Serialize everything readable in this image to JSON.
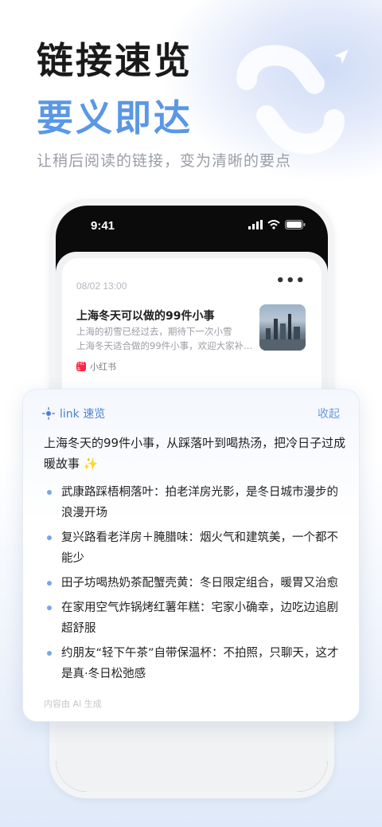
{
  "hero": {
    "title": "链接速览",
    "subtitle": "要义即达",
    "description": "让稍后阅读的链接，变为清晰的要点"
  },
  "status_bar": {
    "time": "9:41"
  },
  "card": {
    "date": "08/02 13:00",
    "more": "•••",
    "title": "上海冬天可以做的99件小事",
    "line1": "上海的初雪已经过去，期待下一次小雪",
    "line2": "上海冬天适合做的99件小事，欢迎大家补...",
    "source_logo": "小红书",
    "source": "小红书"
  },
  "summary": {
    "label": "link 速览",
    "collapse": "收起",
    "lead": "上海冬天的99件小事，从踩落叶到喝热汤，把冷日子过成暖故事 ✨",
    "items": [
      "武康路踩梧桐落叶：拍老洋房光影，是冬日城市漫步的浪漫开场",
      "复兴路看老洋房＋腌腊味：烟火气和建筑美，一个都不能少",
      "田子坊喝热奶茶配蟹壳黄：冬日限定组合，暖胃又治愈",
      "在家用空气炸锅烤红薯年糕：宅家小确幸，边吃边追剧超舒服",
      "约朋友“轻下午茶”自带保温杯：不拍照，只聊天，这才是真·冬日松弛感"
    ],
    "footer": "内容由 AI 生成"
  },
  "colors": {
    "accent": "#5a97e6",
    "summary_blue": "#4a80d4"
  }
}
